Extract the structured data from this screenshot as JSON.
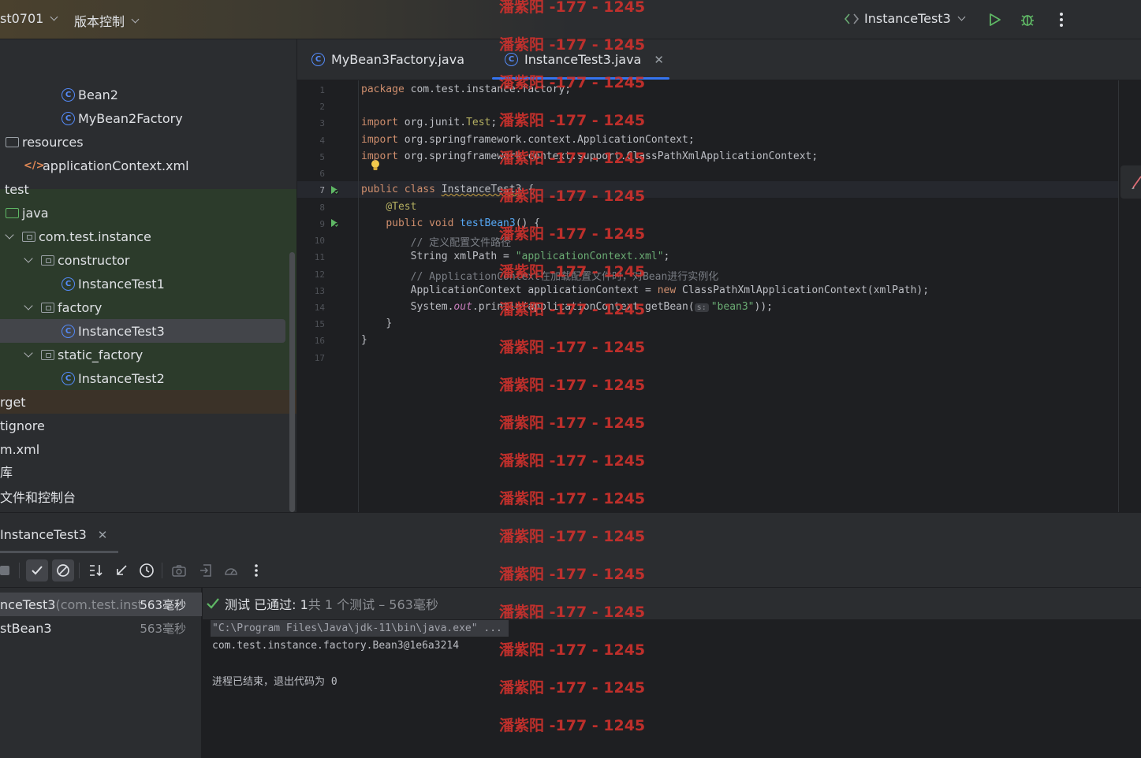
{
  "titlebar": {
    "project": "st0701",
    "vcs": "版本控制",
    "run_config": "InstanceTest3"
  },
  "project_tree": [
    {
      "label": "Bean2",
      "icon": "class-icon"
    },
    {
      "label": "MyBean2Factory",
      "icon": "class-icon"
    },
    {
      "label": "resources",
      "icon": "resources-folder-icon"
    },
    {
      "label": "applicationContext.xml",
      "icon": "xml-file-icon"
    },
    {
      "label": "test",
      "icon": "none"
    },
    {
      "label": "java",
      "icon": "source-folder-icon"
    },
    {
      "label": "com.test.instance",
      "icon": "package-icon"
    },
    {
      "label": "constructor",
      "icon": "package-icon"
    },
    {
      "label": "InstanceTest1",
      "icon": "class-icon"
    },
    {
      "label": "factory",
      "icon": "package-icon"
    },
    {
      "label": "InstanceTest3",
      "icon": "class-icon"
    },
    {
      "label": "static_factory",
      "icon": "package-icon"
    },
    {
      "label": "InstanceTest2",
      "icon": "class-icon"
    },
    {
      "label": "rget",
      "icon": "none"
    },
    {
      "label": "tignore",
      "icon": "none"
    },
    {
      "label": "m.xml",
      "icon": "none"
    },
    {
      "label": "库",
      "icon": "none"
    },
    {
      "label": "文件和控制台",
      "icon": "none"
    }
  ],
  "editor_tabs": [
    {
      "label": "MyBean3Factory.java",
      "active": false
    },
    {
      "label": "InstanceTest3.java",
      "active": true
    }
  ],
  "code": {
    "line_numbers": [
      "1",
      "2",
      "3",
      "4",
      "5",
      "6",
      "7",
      "8",
      "9",
      "10",
      "11",
      "12",
      "13",
      "14",
      "15",
      "16",
      "17"
    ],
    "l1_kw": "package",
    "l1_rest": " com.test.instance.factory;",
    "l3_kw": "import",
    "l3_mid": " org.junit.",
    "l3_cls": "Test",
    "l3_end": ";",
    "l4_kw": "import",
    "l4_rest": " org.springframework.context.ApplicationContext;",
    "l5_kw": "import",
    "l5_rest": " org.springframework.context.support.ClassPathXmlApplicationContext;",
    "l7_kw": "public class",
    "l7_name": "InstanceTest3",
    "l7_end": " {",
    "l8_ann": "@Test",
    "l9_kw": "public void",
    "l9_fn": "testBean3",
    "l9_end": "() {",
    "l10_cm": "// 定义配置文件路径",
    "l11_a": "String xmlPath = ",
    "l11_str": "\"applicationContext.xml\"",
    "l11_end": ";",
    "l12_cm": "// ApplicationContext在加载配置文件时，对Bean进行实例化",
    "l13_a": "ApplicationContext applicationContext = ",
    "l13_kw": "new",
    "l13_b": " ClassPathXmlApplicationContext(xmlPath);",
    "l14_a": "System.",
    "l14_fld": "out",
    "l14_b": ".println(applicationContext.getBean(",
    "l14_hint": "s:",
    "l14_str": "\"bean3\"",
    "l14_end": "));",
    "l15": "}",
    "l16": "}"
  },
  "run_panel": {
    "tab_label": "InstanceTest3",
    "tests": [
      {
        "name": "nceTest3",
        "pkg": " (com.test.inst",
        "time": "563毫秒"
      },
      {
        "name": "stBean3",
        "pkg": "",
        "time": "563毫秒"
      }
    ],
    "status_passed": "测试 已通过: 1",
    "status_total": "共 1 个测试 – 563毫秒",
    "console_cmd": "\"C:\\Program Files\\Java\\jdk-11\\bin\\java.exe\" ...",
    "console_out": "com.test.instance.factory.Bean3@1e6a3214",
    "console_exit": "进程已结束，退出代码为 0"
  },
  "watermark": "潘紫阳 -177 - 1245",
  "colors": {
    "accent": "#3574f0",
    "keyword": "#cf8e6d",
    "string": "#6aab73",
    "pass": "#5fb865",
    "watermark": "#d0312d"
  }
}
